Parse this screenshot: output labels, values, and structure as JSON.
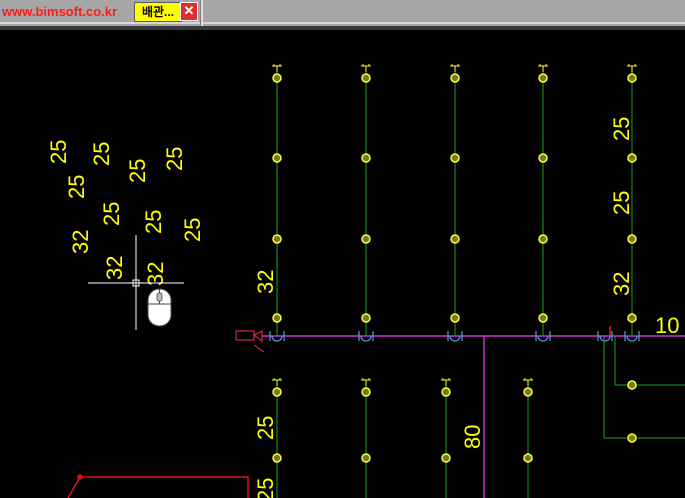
{
  "window": {
    "url_text": "www.bimsoft.co.kr",
    "tab_label": "배관...",
    "close_glyph": "✕"
  },
  "canvas": {
    "background": "#000000",
    "pipe_color": "#1ea51e",
    "main_pipe_color": "#cc33cc",
    "node_color": "#ffff33",
    "text_color": "#ffff00",
    "labels_floating": [
      "25",
      "25",
      "25",
      "25",
      "25",
      "25",
      "25",
      "25",
      "32",
      "32",
      "32"
    ],
    "labels_pipes": [
      "25",
      "25",
      "32",
      "32",
      "10",
      "25",
      "80",
      "25"
    ]
  }
}
